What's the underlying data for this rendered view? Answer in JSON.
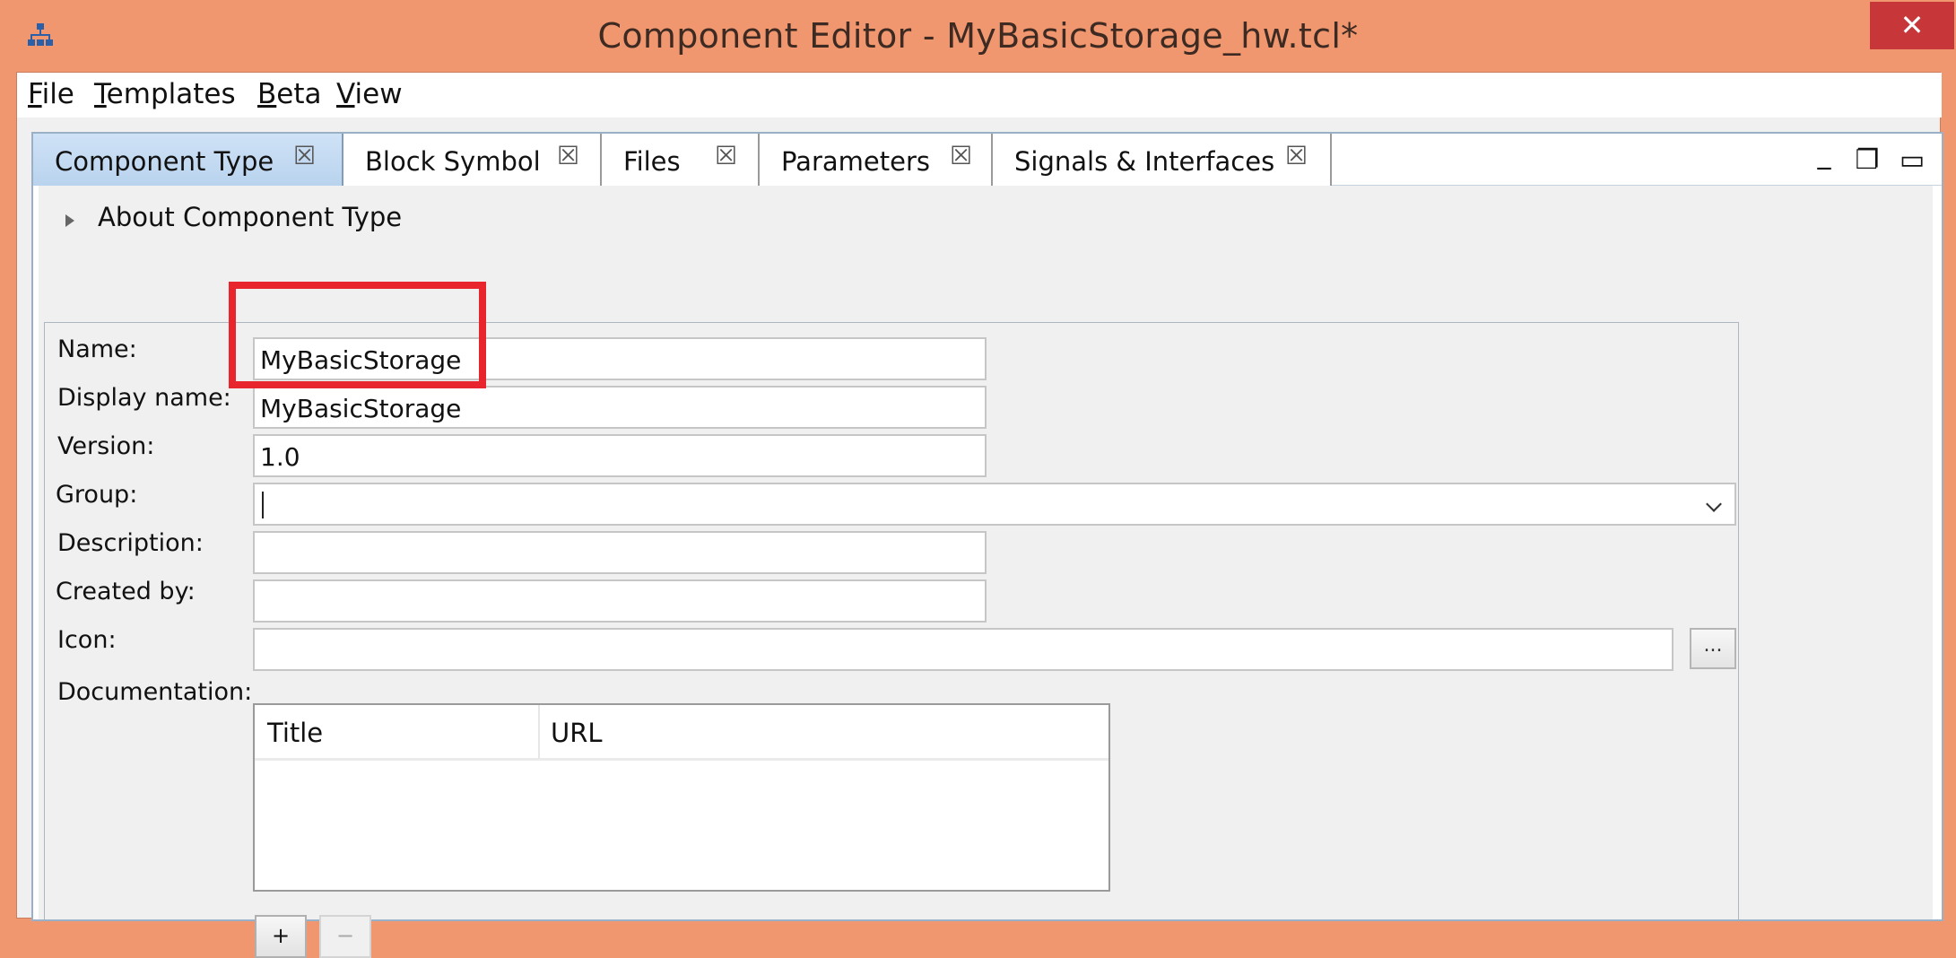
{
  "window": {
    "title": "Component Editor - MyBasicStorage_hw.tcl*",
    "close_glyph": "✕",
    "app_icon": "network-hierarchy-icon"
  },
  "menubar": {
    "items": [
      {
        "label_u": "F",
        "label_rest": "ile"
      },
      {
        "label_u": "T",
        "label_rest": "emplates"
      },
      {
        "label_u": "B",
        "label_rest": "eta"
      },
      {
        "label_u": "V",
        "label_rest": "iew"
      }
    ]
  },
  "tabs": [
    {
      "label": "Component Type",
      "active": true
    },
    {
      "label": "Block Symbol",
      "active": false
    },
    {
      "label": "Files",
      "active": false
    },
    {
      "label": "Parameters",
      "active": false
    },
    {
      "label": "Signals & Interfaces",
      "active": false
    }
  ],
  "tab_close_glyph": "☒",
  "view_controls": {
    "minimize": "_",
    "restore": "❐",
    "maximize": "▭"
  },
  "about": {
    "label": "About Component Type"
  },
  "form": {
    "name_label": "Name:",
    "name_value": "MyBasicStorage",
    "display_name_label": "Display name:",
    "display_name_value": "MyBasicStorage",
    "version_label": "Version:",
    "version_value": "1.0",
    "group_label": "Group:",
    "group_value": "",
    "description_label": "Description:",
    "description_value": "",
    "created_by_label": "Created by:",
    "created_by_value": "",
    "icon_label": "Icon:",
    "icon_value": "",
    "browse_label": "...",
    "documentation_label": "Documentation:"
  },
  "documentation_table": {
    "columns": [
      "Title",
      "URL"
    ],
    "rows": []
  },
  "doc_buttons": {
    "add": "+",
    "remove": "−"
  },
  "accent_colors": {
    "title_bar": "#f0976f",
    "close_button": "#c7373a",
    "highlight_box": "#e8242c",
    "active_tab": "#bcd5ef"
  }
}
